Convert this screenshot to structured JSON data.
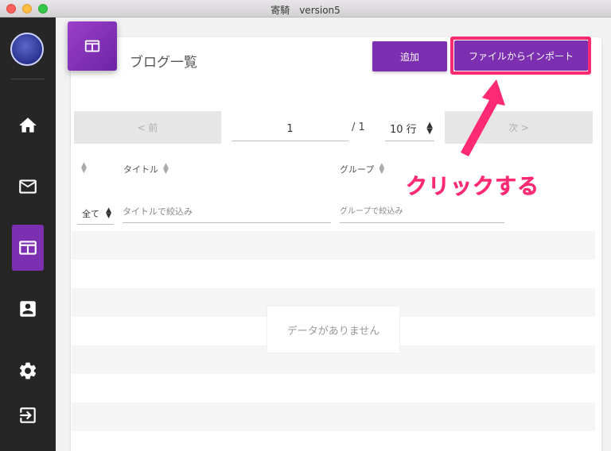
{
  "window": {
    "title": "寄騎　version5"
  },
  "sidebar": {
    "items": [
      {
        "name": "home",
        "icon": "home-icon"
      },
      {
        "name": "mail",
        "icon": "mail-icon"
      },
      {
        "name": "blog",
        "icon": "blog-list-icon",
        "active": true
      },
      {
        "name": "contact",
        "icon": "contact-card-icon"
      },
      {
        "name": "settings",
        "icon": "gear-icon"
      },
      {
        "name": "logout",
        "icon": "logout-icon"
      }
    ],
    "accent_color": "#7c2fb0"
  },
  "page": {
    "title": "ブログ一覧",
    "badge_icon": "blog-list-icon"
  },
  "toolbar": {
    "add_label": "追加",
    "import_label": "ファイルからインポート"
  },
  "pagination": {
    "prev_label": "< 前",
    "next_label": "次 >",
    "current_page": "1",
    "total": "/ 1",
    "rows_per_page": "10 行"
  },
  "table": {
    "columns": [
      "タイトル",
      "グループ"
    ],
    "filters": {
      "all_label": "全て",
      "title_placeholder": "タイトルで絞込み",
      "group_placeholder": "グループで絞込み"
    },
    "empty_message": "データがありません"
  },
  "annotation": {
    "text": "クリックする",
    "color": "#ff2a74"
  }
}
